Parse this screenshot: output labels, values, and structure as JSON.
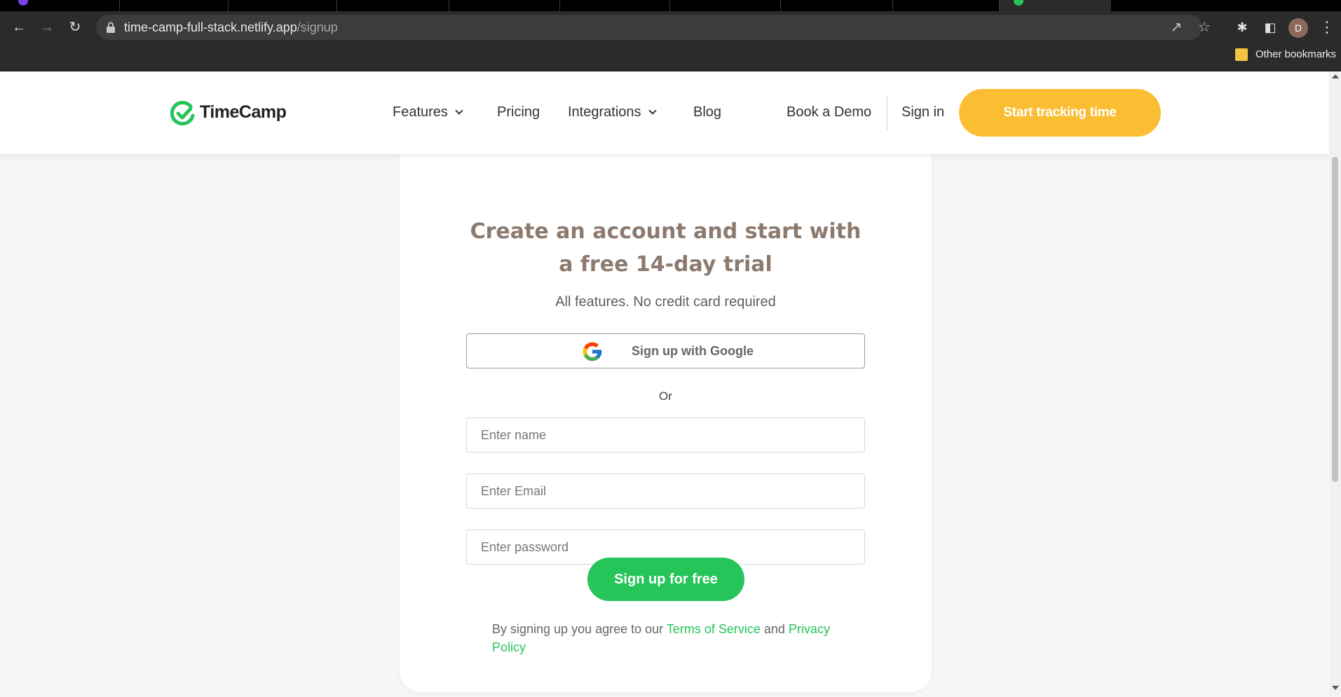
{
  "browser": {
    "url_host": "time-camp-full-stack.netlify.app",
    "url_path": "/signup",
    "profile_initial": "D",
    "bookmark_label": "Other bookmarks"
  },
  "header": {
    "logo_text": "TimeCamp",
    "nav": {
      "features": "Features",
      "pricing": "Pricing",
      "integrations": "Integrations",
      "blog": "Blog",
      "book_demo": "Book a Demo",
      "sign_in": "Sign in"
    },
    "cta_label": "Start tracking time"
  },
  "signup": {
    "subtitle": "Create an account and start with a free 14-day trial",
    "note": "All features. No credit card required",
    "google_button": "Sign up with Google",
    "or_label": "Or",
    "name_placeholder": "Enter name",
    "email_placeholder": "Enter Email",
    "password_placeholder": "Enter password",
    "submit_label": "Sign up for free",
    "terms_prefix": "By signing up you agree to our ",
    "terms_link": "Terms of Service",
    "terms_middle": " and ",
    "privacy_link": "Privacy Policy"
  },
  "colors": {
    "brand_green": "#25c55a",
    "cta_yellow": "#fbbd32",
    "subtitle_brown": "#8c7a6e"
  }
}
